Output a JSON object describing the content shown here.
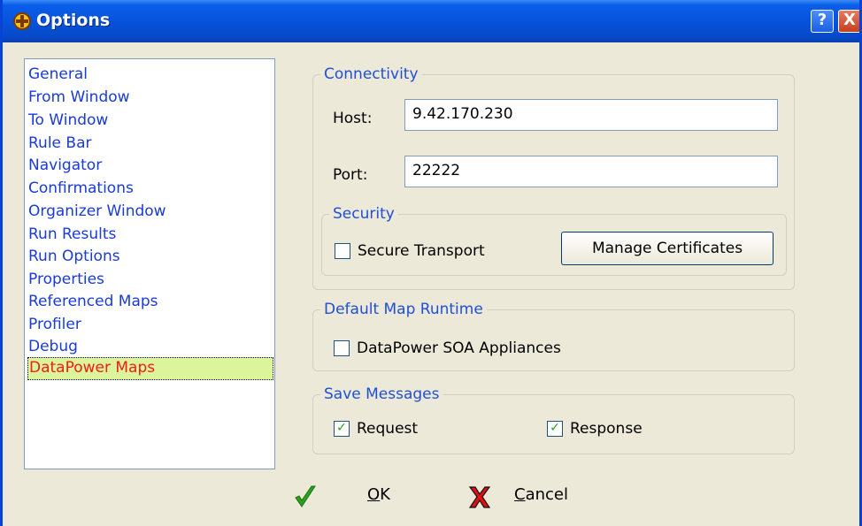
{
  "window": {
    "title": "Options",
    "help_symbol": "?",
    "close_symbol": "X"
  },
  "categories": [
    {
      "label": "General"
    },
    {
      "label": "From Window"
    },
    {
      "label": "To Window"
    },
    {
      "label": "Rule Bar"
    },
    {
      "label": "Navigator"
    },
    {
      "label": "Confirmations"
    },
    {
      "label": "Organizer Window"
    },
    {
      "label": "Run Results"
    },
    {
      "label": "Run Options"
    },
    {
      "label": "Properties"
    },
    {
      "label": "Referenced Maps"
    },
    {
      "label": "Profiler"
    },
    {
      "label": "Debug"
    },
    {
      "label": "DataPower Maps",
      "selected": true
    }
  ],
  "connectivity": {
    "legend": "Connectivity",
    "host_label": "Host:",
    "host_value": "9.42.170.230",
    "port_label": "Port:",
    "port_value": "22222",
    "security": {
      "legend": "Security",
      "secure_transport_label": "Secure Transport",
      "secure_transport_checked": false,
      "manage_certificates_label": "Manage Certificates"
    }
  },
  "default_runtime": {
    "legend": "Default Map Runtime",
    "datapower_label": "DataPower SOA Appliances",
    "datapower_checked": false
  },
  "save_messages": {
    "legend": "Save Messages",
    "request_label": "Request",
    "request_checked": true,
    "response_label": "Response",
    "response_checked": true
  },
  "footer": {
    "ok_mnemonic": "O",
    "ok_rest": "K",
    "cancel_mnemonic": "C",
    "cancel_rest": "ancel"
  },
  "colors": {
    "title_bar": "#0753dc",
    "list_text": "#1a3bd8",
    "selected_bg": "#ddf59a",
    "selected_text": "#f21a1a",
    "legend_text": "#1f4fd6"
  },
  "icons": {
    "app": "options-app-icon",
    "help": "help-icon",
    "close": "close-icon",
    "ok": "green-checkmark-icon",
    "cancel": "red-x-icon"
  }
}
